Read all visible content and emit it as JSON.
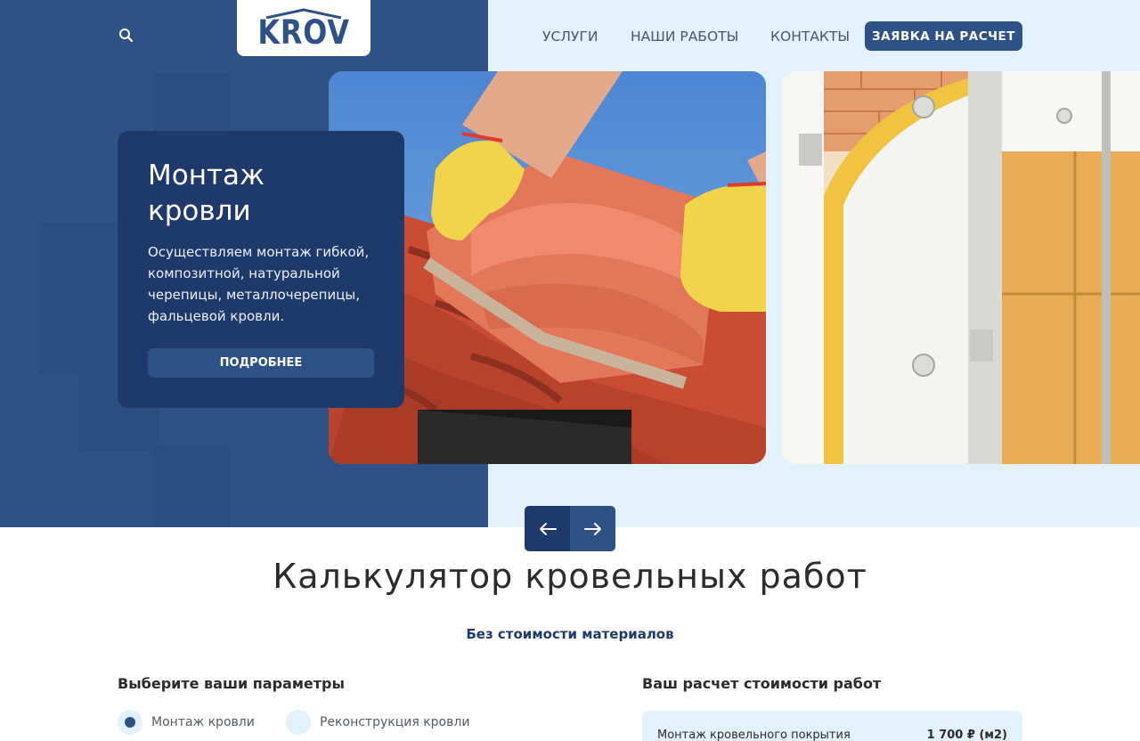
{
  "header": {
    "logo_text": "KROV",
    "nav": [
      "УСЛУГИ",
      "НАШИ РАБОТЫ",
      "КОНТАКТЫ"
    ],
    "cta_label": "ЗАЯВКА НА РАСЧЕТ",
    "search_icon": "search-icon"
  },
  "hero": {
    "title": "Монтаж кровли",
    "text": "Осуществляем монтаж гибкой, композитной, натуральной черепицы, металлочерепицы, фальцевой кровли.",
    "button_label": "ПОДРОБНЕЕ",
    "prev_icon": "arrow-left-icon",
    "next_icon": "arrow-right-icon"
  },
  "calculator": {
    "title": "Калькулятор кровельных работ",
    "subtitle": "Без стоимости материалов",
    "params_title": "Выберите ваши параметры",
    "options": [
      "Монтаж кровли",
      "Реконструкция кровли"
    ],
    "selected_option": "Монтаж кровли",
    "result_title": "Ваш расчет стоимости работ",
    "result_item": "Монтаж кровельного покрытия",
    "result_price": "1 700 ₽ (м2)"
  },
  "colors": {
    "primary": "#2e5286",
    "dark": "#1f3a6a",
    "light": "#e3f1fc"
  }
}
